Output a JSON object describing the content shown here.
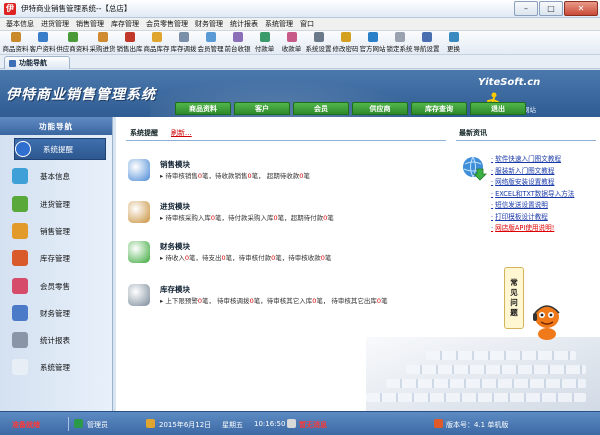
{
  "window": {
    "title": "伊特商业销售管理系统--【总店】",
    "app_icon": "伊"
  },
  "menu": [
    "基本信息",
    "进货管理",
    "销售管理",
    "库存管理",
    "会员零售管理",
    "财务管理",
    "统计报表",
    "系统管理",
    "窗口"
  ],
  "toolbar": [
    {
      "label": "商品资料",
      "icon": "box-icon",
      "color": "#c88a2a"
    },
    {
      "label": "客户资料",
      "icon": "customer-icon",
      "color": "#3a7dc9"
    },
    {
      "label": "供应商资料",
      "icon": "supplier-icon",
      "color": "#4a9a3a"
    },
    {
      "label": "采购进货",
      "icon": "purchase-icon",
      "color": "#d08a30"
    },
    {
      "label": "销售出库",
      "icon": "sales-icon",
      "color": "#c0392b"
    },
    {
      "label": "商品库存",
      "icon": "stock-icon",
      "color": "#e0a52e"
    },
    {
      "label": "库存调拨",
      "icon": "transfer-icon",
      "color": "#7a8fa8"
    },
    {
      "label": "会员管理",
      "icon": "member-icon",
      "color": "#5b9bd5"
    },
    {
      "label": "前台收银",
      "icon": "cashier-icon",
      "color": "#8a6fb8"
    },
    {
      "label": "付款单",
      "icon": "payment-icon",
      "color": "#3a9a6a"
    },
    {
      "label": "收款单",
      "icon": "receipt-icon",
      "color": "#c85a8a"
    },
    {
      "label": "系统设置",
      "icon": "settings-icon",
      "color": "#6a7a8a"
    },
    {
      "label": "修改密码",
      "icon": "key-icon",
      "color": "#d4a020"
    },
    {
      "label": "官方网站",
      "icon": "globe-icon",
      "color": "#2a80c8"
    },
    {
      "label": "锁定系统",
      "icon": "lock-icon",
      "color": "#9aa2b0"
    },
    {
      "label": "导航设置",
      "icon": "nav-icon",
      "color": "#4a6fb0"
    },
    {
      "label": "更换",
      "icon": "switch-icon",
      "color": "#3a8ac0"
    }
  ],
  "nav_tab": "功能导航",
  "banner": {
    "title": "伊特商业销售管理系统",
    "site": "YiteSoft.cn",
    "official": "官方网站",
    "tabs": [
      "商品资料",
      "客户",
      "会员",
      "供应商",
      "库存查询",
      "退出"
    ]
  },
  "sidebar": {
    "header": "功能导航",
    "items": [
      {
        "label": "系统提醒",
        "icon": "info-icon",
        "color": "#2f6fd0"
      },
      {
        "label": "基本信息",
        "icon": "cubes-icon",
        "color": "#3fa0d8"
      },
      {
        "label": "进货管理",
        "icon": "cart-icon",
        "color": "#5aa83a"
      },
      {
        "label": "销售管理",
        "icon": "tag-icon",
        "color": "#e29a2a"
      },
      {
        "label": "库存管理",
        "icon": "warehouse-icon",
        "color": "#d95a2a"
      },
      {
        "label": "会员零售",
        "icon": "member-icon",
        "color": "#d64a6a"
      },
      {
        "label": "财务管理",
        "icon": "finance-icon",
        "color": "#4a7ac8"
      },
      {
        "label": "统计报表",
        "icon": "gears-icon",
        "color": "#8a96a8"
      },
      {
        "label": "系统管理",
        "icon": "system-icon",
        "color": "#e8eef6"
      }
    ]
  },
  "reminder": {
    "header": "系统提醒",
    "refresh": "刷新...",
    "modules": [
      {
        "title": "销售模块",
        "icon": "book-icon",
        "color": "#4a8ad6",
        "line": [
          [
            "待审核销售",
            "0"
          ],
          [
            "笔，待收款销售",
            "0"
          ],
          [
            "笔， 超期待收款",
            "0"
          ],
          [
            "笔",
            null
          ]
        ]
      },
      {
        "title": "进货模块",
        "icon": "crate-icon",
        "color": "#c8903a",
        "line": [
          [
            "待审核采购入库",
            "0"
          ],
          [
            "笔，待付款采购入库",
            "0"
          ],
          [
            "笔，超期待付款",
            "0"
          ],
          [
            "笔",
            null
          ]
        ]
      },
      {
        "title": "财务模块",
        "icon": "money-icon",
        "color": "#3aa83a",
        "line": [
          [
            "待收入",
            "0"
          ],
          [
            "笔，待支出",
            "0"
          ],
          [
            "笔，待审核付款",
            "0"
          ],
          [
            "笔，待审核收款",
            "0"
          ],
          [
            "笔",
            null
          ]
        ]
      },
      {
        "title": "库存模块",
        "icon": "disk-icon",
        "color": "#7a8a9a",
        "line": [
          [
            "上下限预警",
            "0"
          ],
          [
            "笔，    待审核调拨",
            "0"
          ],
          [
            "笔，待审核其它入库",
            "0"
          ],
          [
            "笔，  待审核其它出库",
            "0"
          ],
          [
            "笔",
            null
          ]
        ]
      }
    ]
  },
  "news": {
    "header": "最新资讯",
    "items": [
      {
        "text": "软件快速入门图文教程",
        "hot": false
      },
      {
        "text": "服装新入门图文教程",
        "hot": false
      },
      {
        "text": "网络版安装设置教程",
        "hot": false
      },
      {
        "text": "EXCEL和TXT数据导入方法",
        "hot": false
      },
      {
        "text": "短信发送设置说明",
        "hot": false
      },
      {
        "text": "打印模板设计教程",
        "hot": false
      },
      {
        "text": "网店版API使用说明!",
        "hot": true
      }
    ]
  },
  "faq": [
    "常",
    "见",
    "问",
    "题"
  ],
  "status": {
    "ready": "准备就绪",
    "user": "管理员",
    "date": "2015年6月12日",
    "weekday": "星期五",
    "time": "10:16:50",
    "message": "暂无消息",
    "version": "版本号：4.1 单机版"
  }
}
